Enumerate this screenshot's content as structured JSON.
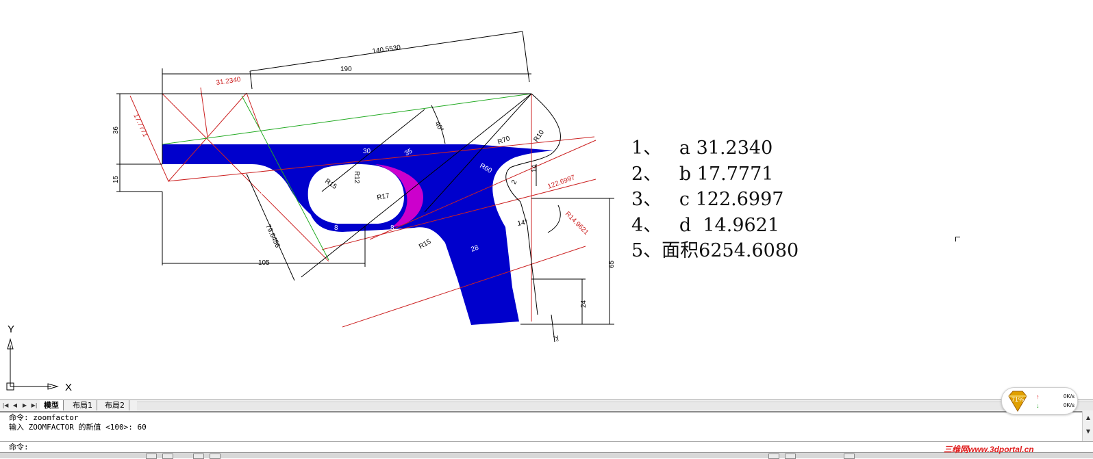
{
  "drawing": {
    "dimensions": {
      "d140": "140.5530",
      "d190": "190",
      "d31": "31.2340",
      "d17": "17.7771",
      "d36": "36",
      "d15": "15",
      "d105": "105",
      "d79": "79.6456",
      "d40": "40°",
      "d30": "30",
      "d35": "35",
      "r70": "R70",
      "r10": "R10",
      "r12": "R12",
      "r15a": "R15",
      "r20": "R20",
      "r17": "R17",
      "r60": "R60",
      "r15b": "R15",
      "d14a": "14",
      "d2": "2",
      "d122": "122.6997",
      "r14": "R14.9621",
      "d14b": "14°",
      "d8a": "8",
      "d8b": "8",
      "d28": "28",
      "d65": "65",
      "d24": "24",
      "d7": "7°"
    },
    "annotations": [
      "1、   a 31.2340",
      "2、   b 17.7771",
      "3、   c 122.6997",
      "4、   d  14.9621",
      "5、面积6254.6080"
    ],
    "ucs": {
      "x_label": "X",
      "y_label": "Y"
    },
    "colors": {
      "fill_blue": "#0000cc",
      "fill_magenta": "#cc00cc",
      "red_line": "#cc2222",
      "green_line": "#22aa22"
    }
  },
  "layout_tabs": {
    "nav": [
      "|◀",
      "◀",
      "▶",
      "▶|"
    ],
    "tabs": [
      "模型",
      "布局1",
      "布局2"
    ],
    "active": "模型"
  },
  "command": {
    "history": [
      "命令: zoomfactor",
      "输入 ZOOMFACTOR 的新值 <100>: 60"
    ],
    "prompt": "命令:"
  },
  "net_widget": {
    "percent": "71%",
    "up": "0K/s",
    "down": "0K/s",
    "up_arrow": "↑",
    "down_arrow": "↓"
  },
  "watermark": "三维网www.3dportal.cn"
}
